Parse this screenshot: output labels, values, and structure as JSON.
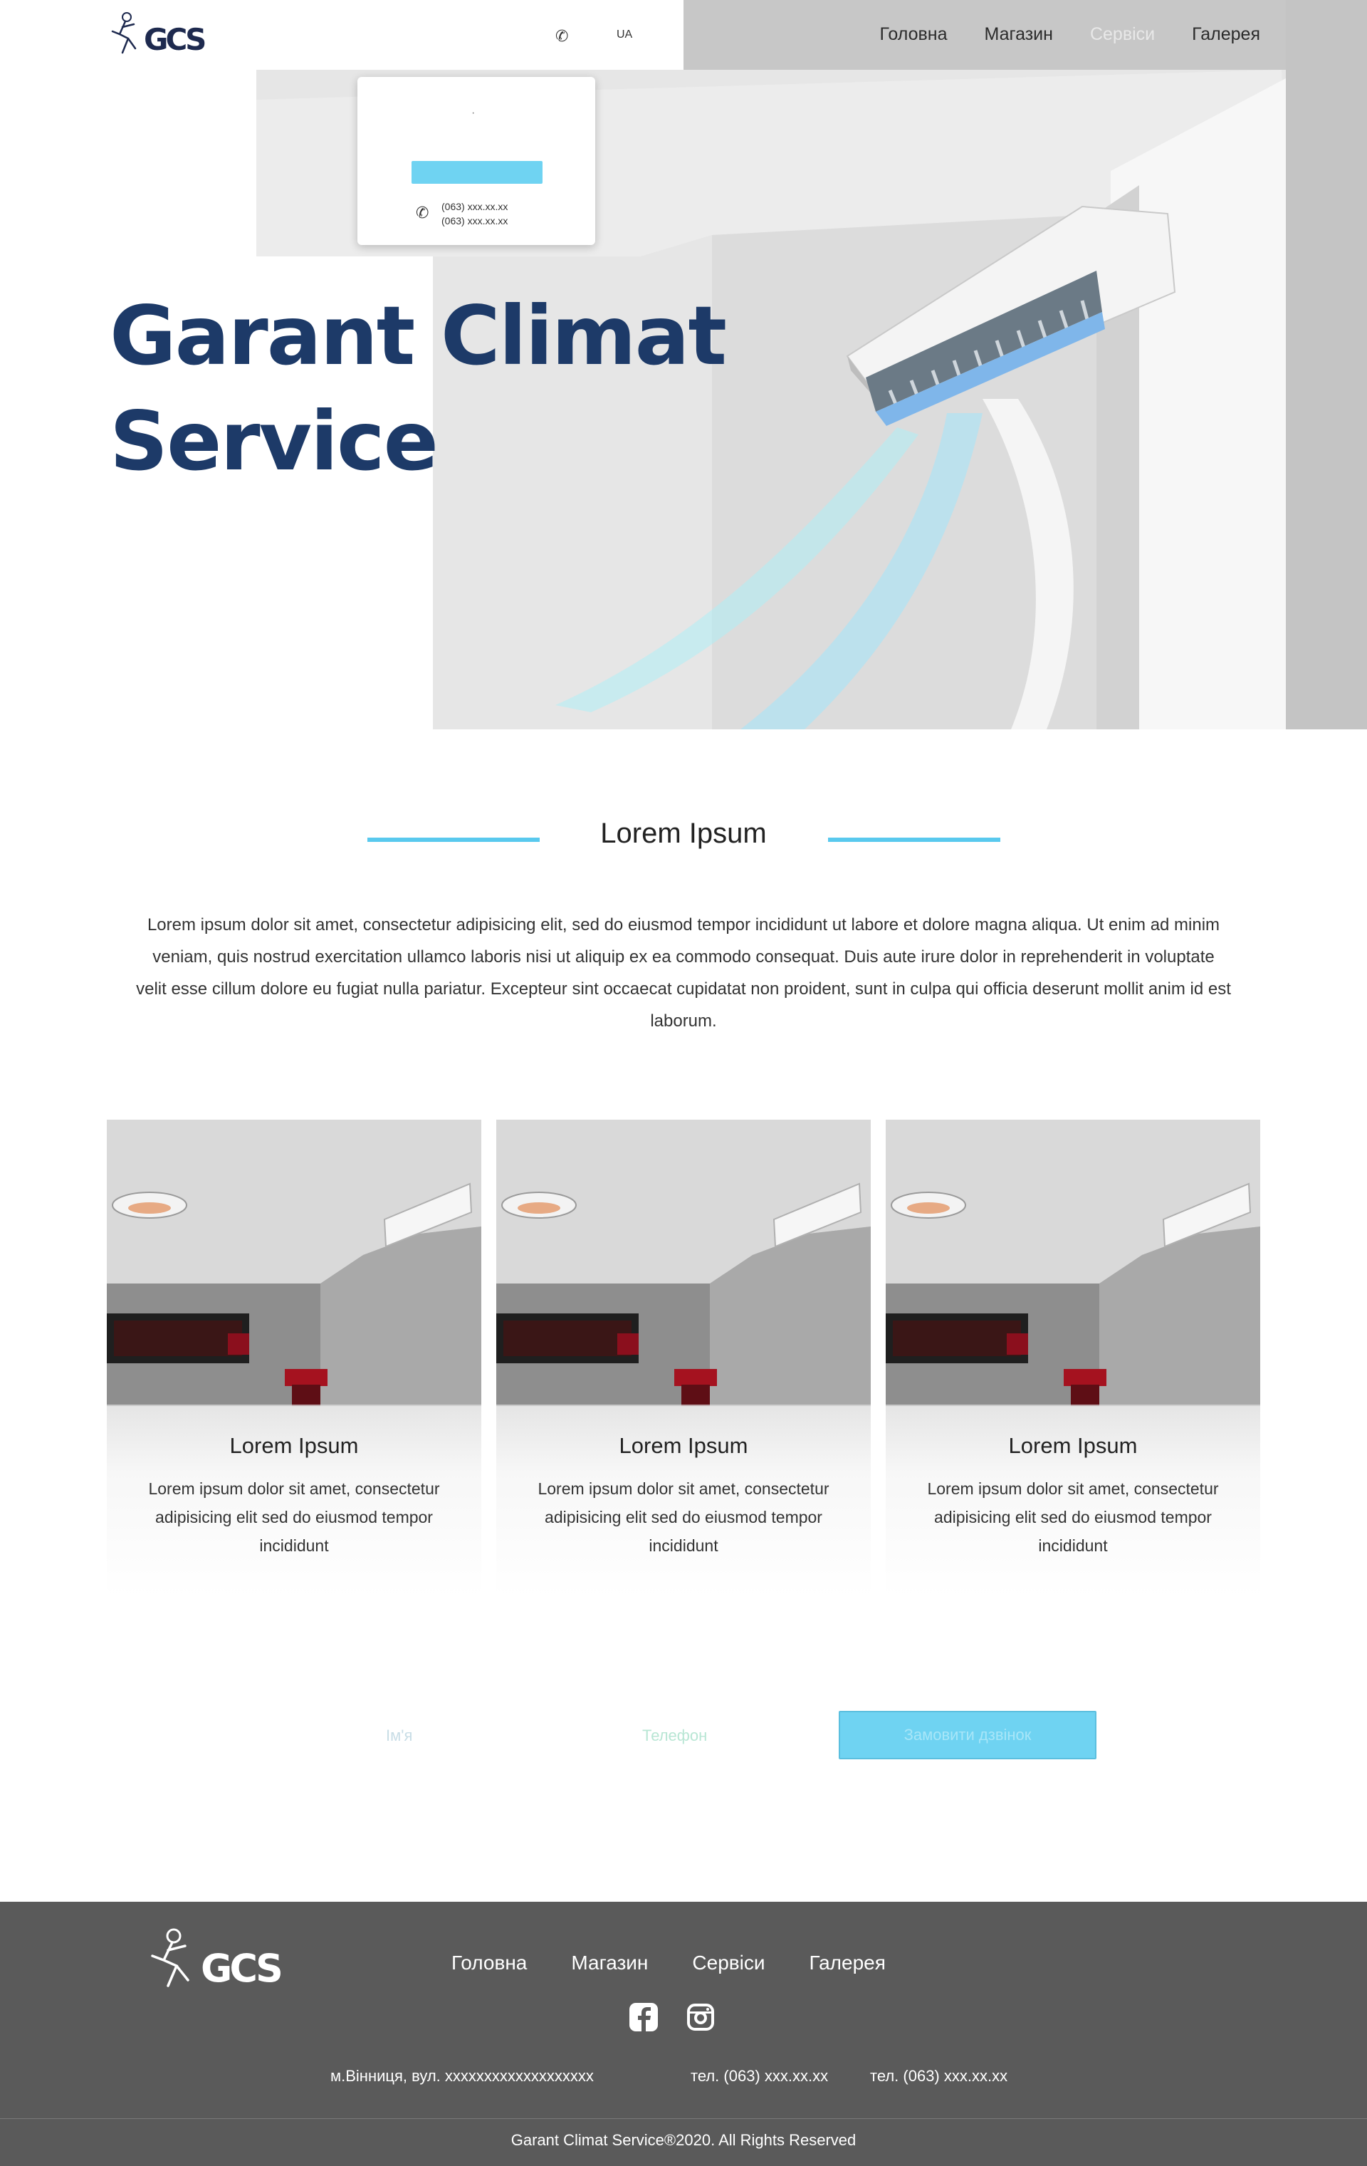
{
  "header": {
    "logo_text": "GCS",
    "language": "UA",
    "nav": [
      "Головна",
      "Магазин",
      "Сервіси",
      "Галерея"
    ]
  },
  "phone_card": {
    "numbers": [
      "(063) xxx.xx.xx",
      "(063) xxx.xx.xx"
    ]
  },
  "hero": {
    "title_line1": "Garant Climat",
    "title_line2": "Service"
  },
  "about": {
    "heading": "Lorem Ipsum",
    "text": "Lorem ipsum dolor sit amet, consectetur adipisicing elit, sed do eiusmod tempor incididunt ut labore et dolore magna aliqua. Ut enim ad minim veniam, quis nostrud exercitation ullamco laboris nisi ut aliquip ex ea commodo consequat. Duis aute irure dolor in reprehenderit in voluptate velit esse cillum dolore eu fugiat nulla pariatur. Excepteur sint occaecat cupidatat non proident, sunt in culpa qui officia deserunt mollit anim id est laborum."
  },
  "cards": [
    {
      "title": "Lorem Ipsum",
      "text": "Lorem ipsum dolor sit amet, consectetur adipisicing elit sed do eiusmod tempor incididunt"
    },
    {
      "title": "Lorem Ipsum",
      "text": "Lorem ipsum dolor sit amet, consectetur adipisicing elit sed do eiusmod tempor incididunt"
    },
    {
      "title": "Lorem Ipsum",
      "text": "Lorem ipsum dolor sit amet, consectetur adipisicing elit sed do eiusmod tempor incididunt"
    }
  ],
  "form": {
    "name_label": "Ім'я",
    "phone_label": "Телефон",
    "submit_label": "Замовити дзвінок"
  },
  "footer": {
    "logo_text": "GCS",
    "nav": [
      "Головна",
      "Магазин",
      "Сервіси",
      "Галерея"
    ],
    "address": "м.Вінниця, вул. xxxxxxxxxxxxxxxxxxx",
    "phone1": "тел. (063) xxx.xx.xx",
    "phone2": "тел. (063) xxx.xx.xx",
    "copyright": "Garant Climat Service®2020. All Rights Reserved"
  },
  "icons": {
    "phone": "phone-icon",
    "facebook": "facebook-icon",
    "instagram": "instagram-icon"
  },
  "colors": {
    "accent": "#6fd3f2",
    "heading": "#1d3a68",
    "footer_bg": "#5a5a5a"
  }
}
